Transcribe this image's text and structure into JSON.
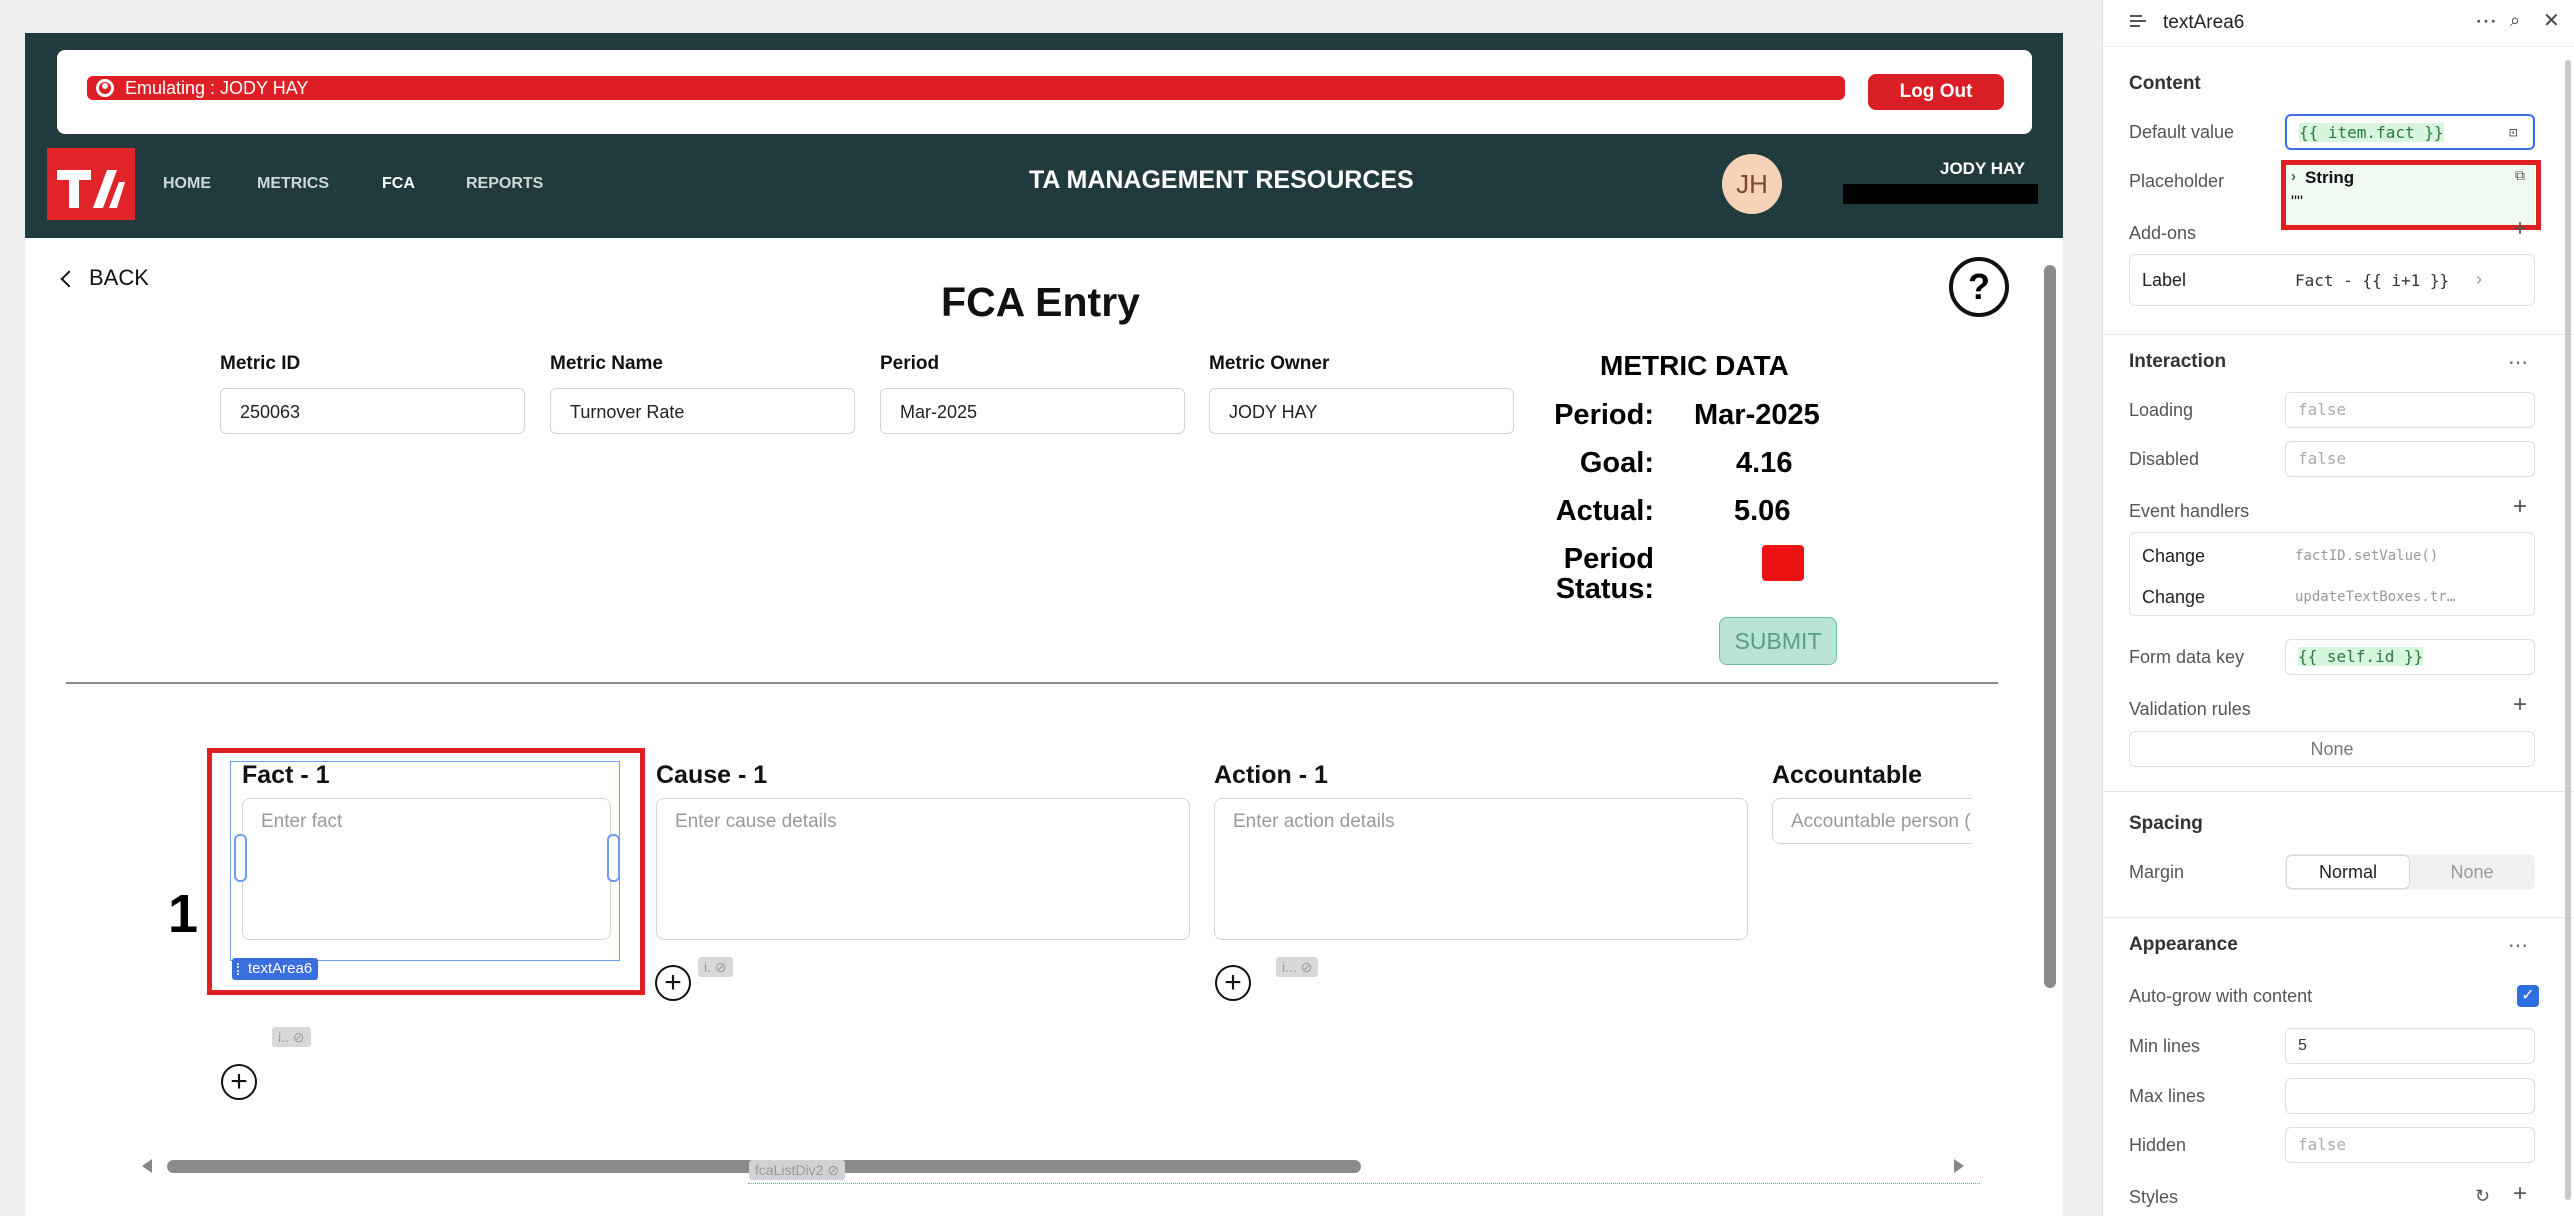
{
  "app": {
    "emulating": "Emulating : JODY HAY",
    "logout": "Log Out",
    "nav": [
      "HOME",
      "METRICS",
      "FCA",
      "REPORTS"
    ],
    "title": "TA MANAGEMENT RESOURCES",
    "avatar": "JH",
    "username": "JODY HAY"
  },
  "page": {
    "back": "BACK",
    "title": "FCA Entry",
    "help": "?",
    "fields": [
      {
        "label": "Metric ID",
        "value": "250063"
      },
      {
        "label": "Metric Name",
        "value": "Turnover Rate"
      },
      {
        "label": "Period",
        "value": "Mar-2025"
      },
      {
        "label": "Metric Owner",
        "value": "JODY HAY"
      }
    ],
    "metric_data": {
      "title": "METRIC DATA",
      "period_label": "Period:",
      "period": "Mar-2025",
      "goal_label": "Goal:",
      "goal": "4.16",
      "actual_label": "Actual:",
      "actual": "5.06",
      "status_label_1": "Period",
      "status_label_2": "Status:",
      "status_color": "#ee1111"
    },
    "submit": "SUBMIT",
    "row_number": "1",
    "columns": [
      {
        "header": "Fact - 1",
        "placeholder": "Enter fact"
      },
      {
        "header": "Cause - 1",
        "placeholder": "Enter cause details"
      },
      {
        "header": "Action - 1",
        "placeholder": "Enter action details"
      },
      {
        "header": "Accountable",
        "placeholder": "Accountable person ("
      }
    ],
    "selected_component": "textArea6",
    "chip_short_1": "i.",
    "chip_short_2": "i...",
    "chip_short_3": "i..",
    "list_div": "fcaListDiv2"
  },
  "panel": {
    "title": "textArea6",
    "content": "Content",
    "default_value_label": "Default value",
    "default_value": "{{ item.fact }}",
    "placeholder_label": "Placeholder",
    "placeholder_type": "String",
    "placeholder_value": "\"\"",
    "addons": "Add-ons",
    "label_label": "Label",
    "label_value": "Fact - {{ i+1 }}",
    "interaction": "Interaction",
    "loading_label": "Loading",
    "loading": "false",
    "disabled_label": "Disabled",
    "disabled": "false",
    "event_handlers": "Event handlers",
    "handlers": [
      {
        "event": "Change",
        "action": "factID.setValue()"
      },
      {
        "event": "Change",
        "action": "updateTextBoxes.tr…"
      }
    ],
    "form_data_key_label": "Form data key",
    "form_data_key": "{{ self.id }}",
    "validation_rules": "Validation rules",
    "validation_none": "None",
    "spacing": "Spacing",
    "margin_label": "Margin",
    "margin_normal": "Normal",
    "margin_none": "None",
    "appearance": "Appearance",
    "autogrow_label": "Auto-grow with content",
    "min_lines_label": "Min lines",
    "min_lines": "5",
    "max_lines_label": "Max lines",
    "hidden_label": "Hidden",
    "hidden": "false",
    "styles": "Styles"
  },
  "colors": {
    "brand_dark": "#203a3d",
    "brand_red": "#e01e26",
    "selection": "#e02020",
    "accent_blue": "#3b6fe0"
  }
}
